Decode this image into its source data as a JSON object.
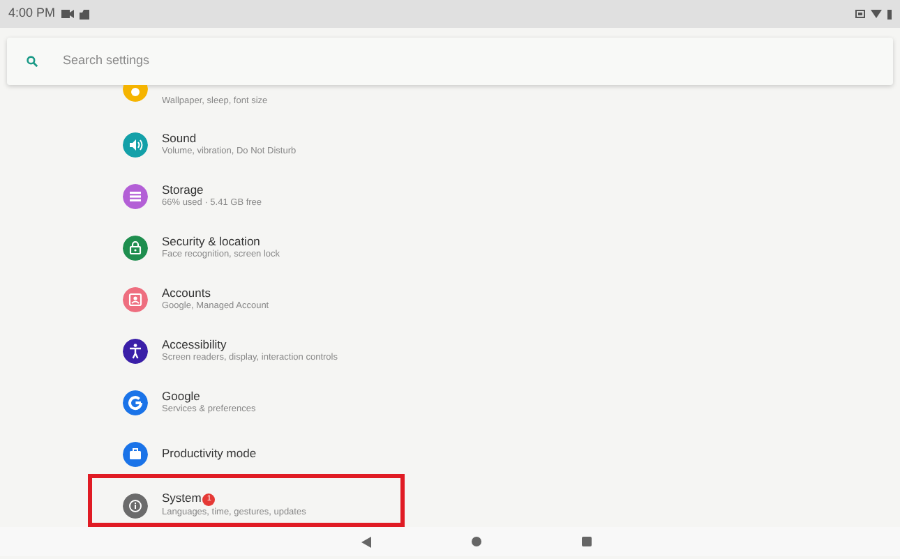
{
  "status_bar": {
    "time": "4:00 PM"
  },
  "search": {
    "placeholder": "Search settings"
  },
  "items": [
    {
      "kind": "partial",
      "color": "#f5b400",
      "subtitle": "Wallpaper, sleep, font size",
      "highlighted": false
    },
    {
      "kind": "full",
      "color": "#13a0a8",
      "title": "Sound",
      "subtitle": "Volume, vibration, Do Not Disturb",
      "highlighted": false
    },
    {
      "kind": "full",
      "color": "#b35fd6",
      "title": "Storage",
      "subtitle": "66% used · 5.41 GB free",
      "highlighted": false
    },
    {
      "kind": "full",
      "color": "#1e8e4e",
      "title": "Security & location",
      "subtitle": "Face recognition, screen lock",
      "highlighted": false
    },
    {
      "kind": "full",
      "color": "#ee6e7f",
      "title": "Accounts",
      "subtitle": "Google, Managed Account",
      "highlighted": false
    },
    {
      "kind": "full",
      "color": "#3a1fa8",
      "title": "Accessibility",
      "subtitle": "Screen readers, display, interaction controls",
      "highlighted": false
    },
    {
      "kind": "full",
      "color": "#1a73e8",
      "title": "Google",
      "subtitle": "Services & preferences",
      "highlighted": false
    },
    {
      "kind": "full",
      "color": "#1a73e8",
      "title": "Productivity mode",
      "highlighted": false
    },
    {
      "kind": "full",
      "color": "#6b6b6b",
      "title": "System",
      "badge": "1",
      "subtitle": "Languages, time, gestures, updates",
      "highlighted": true
    }
  ]
}
